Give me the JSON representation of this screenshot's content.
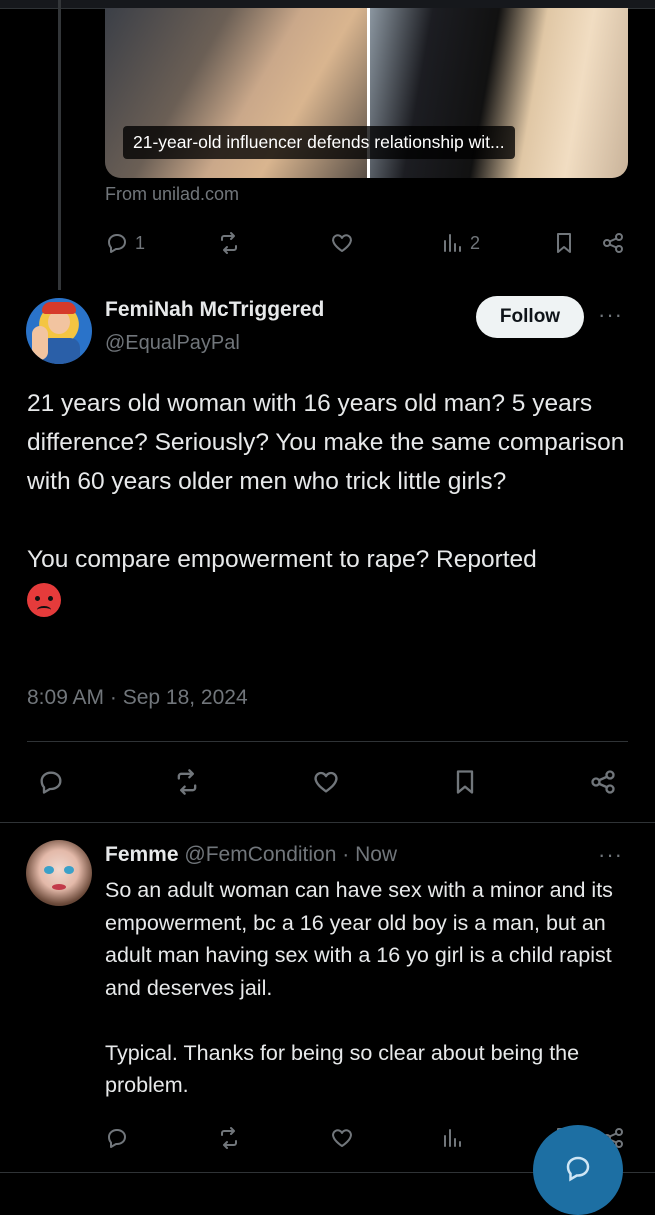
{
  "link_card": {
    "caption": "21-year-old influencer defends relationship wit...",
    "source": "From unilad.com"
  },
  "top_actions": {
    "reply_count": "1",
    "views_count": "2"
  },
  "main_tweet": {
    "display_name": "FemiNah McTriggered",
    "handle": "@EqualPayPal",
    "follow_label": "Follow",
    "more_label": "···",
    "text": "21 years old woman with 16 years old man? 5 years difference? Seriously? You make the same comparison with 60 years older men who trick little girls?\n\nYou compare empowerment to rape? Reported",
    "emoji_name": "angry-face-emoji",
    "timestamp": "8:09 AM · Sep 18, 2024"
  },
  "reply": {
    "display_name": "Femme",
    "handle_and_time": "@FemCondition · Now",
    "more_label": "···",
    "text": "So an adult woman can have sex with a minor and its empowerment, bc a 16 year old boy is a man, but an adult man having sex with a 16 yo girl is a child rapist and deserves jail.\n\nTypical. Thanks for being so clear about being the problem."
  },
  "colors": {
    "background": "#000000",
    "text": "#e7e9ea",
    "muted": "#71767b",
    "divider": "#2f3336",
    "follow_bg": "#eff3f4",
    "fab": "#1d6fa3"
  }
}
